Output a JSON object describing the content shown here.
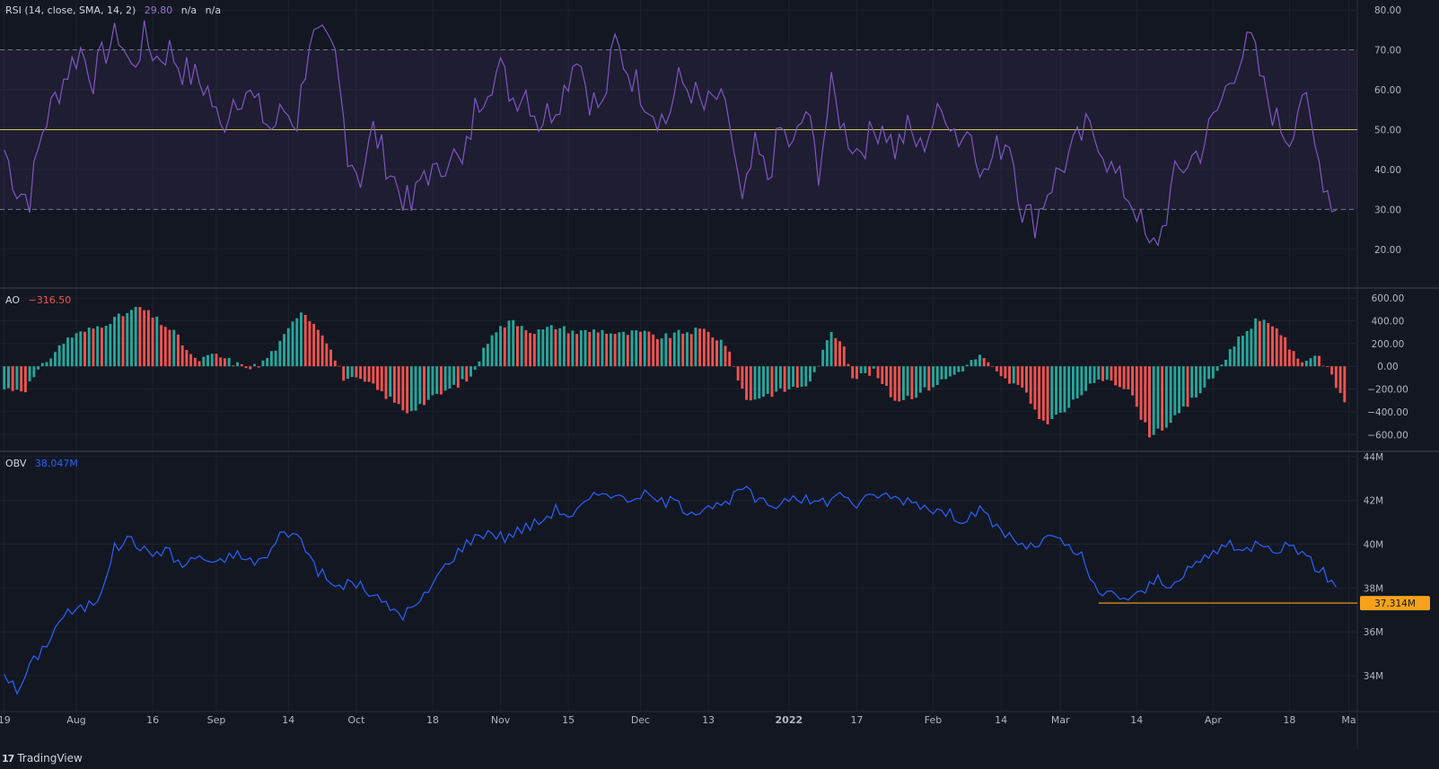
{
  "colors": {
    "background": "#131722",
    "grid": "#1e222d",
    "axis_text": "#b2b5be",
    "rsi_line": "#7e57c2",
    "rsi_band": "#7e57c2",
    "rsi_mid": "#d4c34a",
    "ao_green": "#26a69a",
    "ao_red": "#ef5350",
    "obv_line": "#2962ff",
    "level_line": "#f7a21b",
    "level_label_bg": "#f7a21b",
    "level_label_text": "#131722"
  },
  "legends": {
    "rsi": {
      "title": "RSI (14, close, SMA, 14, 2)",
      "value": "29.80",
      "na1": "n/a",
      "na2": "n/a"
    },
    "ao": {
      "title": "AO",
      "value": "−316.50"
    },
    "obv": {
      "title": "OBV",
      "value": "38.047M"
    }
  },
  "level_label": "37.314M",
  "footer": {
    "brand": "TradingView",
    "brand_icon": "tradingview-logo-icon"
  },
  "chart_data": [
    {
      "type": "line",
      "name": "RSI",
      "y_ticks": [
        "80.00",
        "70.00",
        "60.00",
        "50.00",
        "40.00",
        "30.00",
        "20.00"
      ],
      "ylim": [
        10.5,
        82.5
      ],
      "bands": {
        "upper": 70,
        "middle": 50,
        "lower": 30
      },
      "anchors": [
        [
          0,
          45
        ],
        [
          3,
          35
        ],
        [
          6,
          33
        ],
        [
          9,
          50
        ],
        [
          12,
          58
        ],
        [
          15,
          65
        ],
        [
          18,
          70
        ],
        [
          21,
          63
        ],
        [
          24,
          70
        ],
        [
          27,
          74
        ],
        [
          30,
          65
        ],
        [
          33,
          73
        ],
        [
          36,
          68
        ],
        [
          39,
          70
        ],
        [
          42,
          65
        ],
        [
          45,
          63
        ],
        [
          48,
          60
        ],
        [
          51,
          50
        ],
        [
          54,
          58
        ],
        [
          57,
          60
        ],
        [
          60,
          55
        ],
        [
          63,
          50
        ],
        [
          66,
          55
        ],
        [
          69,
          52
        ],
        [
          72,
          73
        ],
        [
          75,
          72
        ],
        [
          78,
          68
        ],
        [
          81,
          45
        ],
        [
          84,
          38
        ],
        [
          87,
          50
        ],
        [
          90,
          42
        ],
        [
          93,
          35
        ],
        [
          96,
          30
        ],
        [
          99,
          40
        ],
        [
          102,
          38
        ],
        [
          105,
          45
        ],
        [
          108,
          40
        ],
        [
          111,
          55
        ],
        [
          114,
          62
        ],
        [
          117,
          65
        ],
        [
          120,
          58
        ],
        [
          123,
          60
        ],
        [
          126,
          52
        ],
        [
          129,
          55
        ],
        [
          132,
          60
        ],
        [
          135,
          70
        ],
        [
          138,
          58
        ],
        [
          141,
          55
        ],
        [
          144,
          72
        ],
        [
          147,
          65
        ],
        [
          150,
          60
        ],
        [
          153,
          55
        ],
        [
          156,
          52
        ],
        [
          159,
          62
        ],
        [
          162,
          60
        ],
        [
          165,
          55
        ],
        [
          168,
          58
        ],
        [
          171,
          52
        ],
        [
          174,
          30
        ],
        [
          177,
          45
        ],
        [
          180,
          38
        ],
        [
          183,
          50
        ],
        [
          186,
          45
        ],
        [
          189,
          55
        ],
        [
          192,
          40
        ],
        [
          195,
          60
        ],
        [
          198,
          50
        ],
        [
          201,
          45
        ],
        [
          204,
          48
        ],
        [
          207,
          52
        ],
        [
          210,
          45
        ],
        [
          213,
          50
        ],
        [
          216,
          45
        ],
        [
          219,
          52
        ],
        [
          222,
          55
        ],
        [
          225,
          48
        ],
        [
          228,
          50
        ],
        [
          231,
          38
        ],
        [
          234,
          45
        ],
        [
          237,
          48
        ],
        [
          240,
          30
        ],
        [
          243,
          27
        ],
        [
          246,
          35
        ],
        [
          249,
          40
        ],
        [
          252,
          45
        ],
        [
          255,
          50
        ],
        [
          258,
          48
        ],
        [
          261,
          40
        ],
        [
          264,
          35
        ],
        [
          267,
          30
        ],
        [
          270,
          19
        ],
        [
          273,
          25
        ],
        [
          276,
          38
        ],
        [
          279,
          42
        ],
        [
          282,
          45
        ],
        [
          285,
          52
        ],
        [
          288,
          60
        ],
        [
          291,
          68
        ],
        [
          294,
          72
        ],
        [
          297,
          60
        ],
        [
          300,
          52
        ],
        [
          303,
          48
        ],
        [
          306,
          60
        ],
        [
          309,
          45
        ],
        [
          312,
          35
        ],
        [
          314,
          30
        ]
      ]
    },
    {
      "type": "bar",
      "name": "AO",
      "y_ticks": [
        "600.00",
        "400.00",
        "200.00",
        "0.00",
        "−200.00",
        "−400.00",
        "−600.00"
      ],
      "ylim": [
        -740,
        680
      ],
      "anchors": [
        [
          0,
          -200
        ],
        [
          5,
          -200
        ],
        [
          10,
          50
        ],
        [
          15,
          250
        ],
        [
          22,
          350
        ],
        [
          32,
          520
        ],
        [
          40,
          300
        ],
        [
          45,
          50
        ],
        [
          50,
          100
        ],
        [
          56,
          0
        ],
        [
          60,
          0
        ],
        [
          65,
          200
        ],
        [
          70,
          500
        ],
        [
          75,
          300
        ],
        [
          80,
          -100
        ],
        [
          86,
          -150
        ],
        [
          95,
          -400
        ],
        [
          100,
          -300
        ],
        [
          105,
          -200
        ],
        [
          110,
          -100
        ],
        [
          115,
          300
        ],
        [
          120,
          400
        ],
        [
          125,
          300
        ],
        [
          130,
          350
        ],
        [
          135,
          300
        ],
        [
          140,
          320
        ],
        [
          145,
          280
        ],
        [
          150,
          300
        ],
        [
          155,
          250
        ],
        [
          160,
          300
        ],
        [
          165,
          320
        ],
        [
          170,
          200
        ],
        [
          175,
          -300
        ],
        [
          180,
          -250
        ],
        [
          185,
          -200
        ],
        [
          190,
          -150
        ],
        [
          195,
          300
        ],
        [
          198,
          200
        ],
        [
          200,
          -100
        ],
        [
          205,
          -50
        ],
        [
          210,
          -300
        ],
        [
          215,
          -250
        ],
        [
          220,
          -150
        ],
        [
          225,
          -50
        ],
        [
          230,
          100
        ],
        [
          235,
          -100
        ],
        [
          240,
          -200
        ],
        [
          245,
          -500
        ],
        [
          250,
          -400
        ],
        [
          255,
          -200
        ],
        [
          260,
          -100
        ],
        [
          265,
          -200
        ],
        [
          270,
          -600
        ],
        [
          275,
          -500
        ],
        [
          280,
          -300
        ],
        [
          285,
          -100
        ],
        [
          290,
          200
        ],
        [
          295,
          400
        ],
        [
          300,
          350
        ],
        [
          305,
          50
        ],
        [
          310,
          100
        ],
        [
          313,
          -100
        ],
        [
          316,
          -316.5
        ]
      ]
    },
    {
      "type": "line",
      "name": "OBV",
      "y_ticks": [
        "44M",
        "42M",
        "40M",
        "38M",
        "36M",
        "34M"
      ],
      "ylim": [
        32.4,
        44.2
      ],
      "level": 37.314,
      "anchors": [
        [
          0,
          34.2
        ],
        [
          3,
          33.2
        ],
        [
          6,
          34.4
        ],
        [
          10,
          35.5
        ],
        [
          14,
          36.8
        ],
        [
          18,
          37.0
        ],
        [
          22,
          37.5
        ],
        [
          26,
          39.8
        ],
        [
          30,
          40.3
        ],
        [
          34,
          39.5
        ],
        [
          38,
          39.8
        ],
        [
          42,
          39.0
        ],
        [
          46,
          39.5
        ],
        [
          50,
          39.0
        ],
        [
          54,
          39.6
        ],
        [
          58,
          39.2
        ],
        [
          62,
          39.4
        ],
        [
          66,
          40.7
        ],
        [
          70,
          40.2
        ],
        [
          74,
          38.8
        ],
        [
          78,
          38.0
        ],
        [
          82,
          38.3
        ],
        [
          86,
          37.8
        ],
        [
          90,
          37.2
        ],
        [
          94,
          36.8
        ],
        [
          98,
          37.3
        ],
        [
          102,
          38.5
        ],
        [
          106,
          39.5
        ],
        [
          110,
          40.2
        ],
        [
          114,
          40.6
        ],
        [
          118,
          40.3
        ],
        [
          122,
          40.7
        ],
        [
          126,
          41.0
        ],
        [
          130,
          41.6
        ],
        [
          134,
          41.3
        ],
        [
          138,
          42.0
        ],
        [
          142,
          42.5
        ],
        [
          146,
          42.0
        ],
        [
          150,
          42.3
        ],
        [
          154,
          42.0
        ],
        [
          158,
          41.9
        ],
        [
          162,
          41.5
        ],
        [
          166,
          41.8
        ],
        [
          170,
          41.7
        ],
        [
          174,
          42.6
        ],
        [
          178,
          41.9
        ],
        [
          182,
          41.8
        ],
        [
          186,
          42.3
        ],
        [
          190,
          41.9
        ],
        [
          194,
          42.0
        ],
        [
          198,
          42.3
        ],
        [
          201,
          41.8
        ],
        [
          206,
          42.3
        ],
        [
          210,
          42.1
        ],
        [
          214,
          42.0
        ],
        [
          218,
          41.7
        ],
        [
          222,
          41.4
        ],
        [
          226,
          41.2
        ],
        [
          230,
          41.5
        ],
        [
          234,
          40.8
        ],
        [
          238,
          40.2
        ],
        [
          242,
          39.8
        ],
        [
          246,
          40.3
        ],
        [
          250,
          40.0
        ],
        [
          254,
          39.4
        ],
        [
          258,
          37.6
        ],
        [
          262,
          37.8
        ],
        [
          264,
          37.5
        ],
        [
          268,
          37.7
        ],
        [
          272,
          38.5
        ],
        [
          276,
          38.0
        ],
        [
          280,
          39.0
        ],
        [
          284,
          39.5
        ],
        [
          288,
          40.0
        ],
        [
          292,
          39.6
        ],
        [
          296,
          40.2
        ],
        [
          300,
          39.8
        ],
        [
          304,
          40.0
        ],
        [
          308,
          39.2
        ],
        [
          312,
          38.5
        ],
        [
          314,
          38.05
        ]
      ]
    }
  ],
  "x_axis": {
    "ticks": [
      {
        "label": "19",
        "x": 0
      },
      {
        "label": "Aug",
        "x": 17
      },
      {
        "label": "16",
        "x": 35
      },
      {
        "label": "Sep",
        "x": 50
      },
      {
        "label": "14",
        "x": 67
      },
      {
        "label": "Oct",
        "x": 83
      },
      {
        "label": "18",
        "x": 101
      },
      {
        "label": "Nov",
        "x": 117
      },
      {
        "label": "15",
        "x": 133
      },
      {
        "label": "Dec",
        "x": 150
      },
      {
        "label": "13",
        "x": 166
      },
      {
        "label": "2022",
        "x": 185
      },
      {
        "label": "17",
        "x": 201
      },
      {
        "label": "Feb",
        "x": 219
      },
      {
        "label": "14",
        "x": 235
      },
      {
        "label": "Mar",
        "x": 249
      },
      {
        "label": "14",
        "x": 267
      },
      {
        "label": "Apr",
        "x": 285
      },
      {
        "label": "18",
        "x": 303
      },
      {
        "label": "Ma",
        "x": 317
      }
    ],
    "xlim": [
      -1,
      319
    ],
    "last_bar": 316
  }
}
